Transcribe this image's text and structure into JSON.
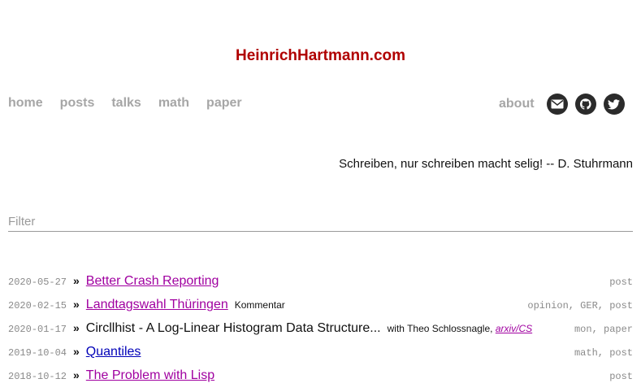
{
  "site": {
    "title": "HeinrichHartmann.com"
  },
  "nav": {
    "left": [
      "home",
      "posts",
      "talks",
      "math",
      "paper"
    ],
    "about": "about",
    "icons": [
      "mail-icon",
      "github-icon",
      "twitter-icon"
    ]
  },
  "quote": "Schreiben, nur schreiben macht selig! -- D. Stuhrmann",
  "filter": {
    "placeholder": "Filter",
    "value": ""
  },
  "posts": [
    {
      "date": "2020-05-27",
      "title": "Better Crash Reporting",
      "extra": "",
      "tags": "post"
    },
    {
      "date": "2020-02-15",
      "title": "Landtagswahl Thüringen",
      "extra": "Kommentar",
      "tags": "opinion, GER, post"
    },
    {
      "date": "2020-01-17",
      "title": "Circllhist - A Log-Linear Histogram Data Structure...",
      "extra": "with Theo Schlossnagle,",
      "extra_link": "arxiv/CS",
      "tags": "mon, paper"
    },
    {
      "date": "2019-10-04",
      "title": "Quantiles",
      "extra": "",
      "tags": "math, post"
    },
    {
      "date": "2018-10-12",
      "title": "The Problem with Lisp",
      "extra": "",
      "tags": "post"
    }
  ],
  "colors": {
    "brand": "#b00000",
    "nav": "#a6a6a6",
    "visited_link": "#a000a0",
    "link": "#0000b8"
  }
}
